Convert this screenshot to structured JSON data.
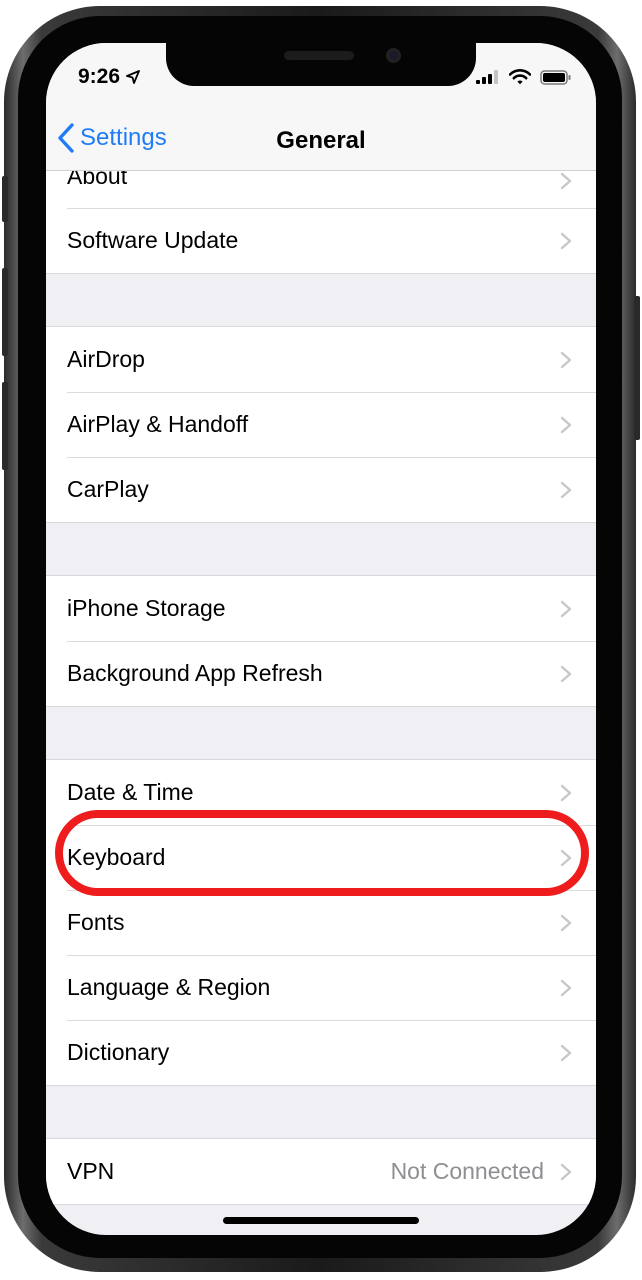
{
  "status_bar": {
    "time": "9:26",
    "icons": [
      "location-arrow-icon",
      "cellular-signal-icon",
      "wifi-icon",
      "battery-icon"
    ]
  },
  "nav": {
    "back_label": "Settings",
    "title": "General"
  },
  "groups": [
    {
      "items": [
        {
          "label": "About",
          "partially_visible": true
        },
        {
          "label": "Software Update"
        }
      ]
    },
    {
      "items": [
        {
          "label": "AirDrop"
        },
        {
          "label": "AirPlay & Handoff"
        },
        {
          "label": "CarPlay"
        }
      ]
    },
    {
      "items": [
        {
          "label": "iPhone Storage"
        },
        {
          "label": "Background App Refresh"
        }
      ]
    },
    {
      "items": [
        {
          "label": "Date & Time"
        },
        {
          "label": "Keyboard",
          "highlighted": true
        },
        {
          "label": "Fonts"
        },
        {
          "label": "Language & Region"
        },
        {
          "label": "Dictionary"
        }
      ]
    },
    {
      "items": [
        {
          "label": "VPN",
          "detail": "Not Connected"
        }
      ]
    }
  ],
  "colors": {
    "accent": "#1f7cf6",
    "highlight_ring": "#ee1c1c",
    "group_background": "#efeff4",
    "detail_text": "#8e8e93"
  }
}
